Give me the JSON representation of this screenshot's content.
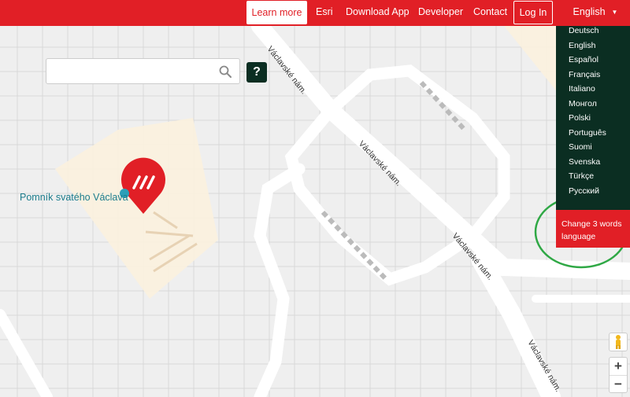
{
  "nav": {
    "learn_more": "Learn more",
    "esri": "Esri",
    "download_app": "Download App",
    "developer": "Developer",
    "contact": "Contact",
    "login": "Log In",
    "language": "English"
  },
  "search": {
    "value": "",
    "placeholder": ""
  },
  "help_label": "?",
  "language_menu": {
    "items": [
      "Deutsch",
      "English",
      "Español",
      "Français",
      "Italiano",
      "Монгол",
      "Polski",
      "Português",
      "Suomi",
      "Svenska",
      "Türkçe",
      "Русский"
    ],
    "change_label": "Change 3 words language"
  },
  "map": {
    "place_name": "Pomník svatého Václava",
    "street_name": "Václavské nám.",
    "zoom_in": "+",
    "zoom_out": "−"
  },
  "colors": {
    "brand_red": "#e11f26",
    "menu_bg": "#0b2e22",
    "annotation_green": "#2fa845"
  }
}
